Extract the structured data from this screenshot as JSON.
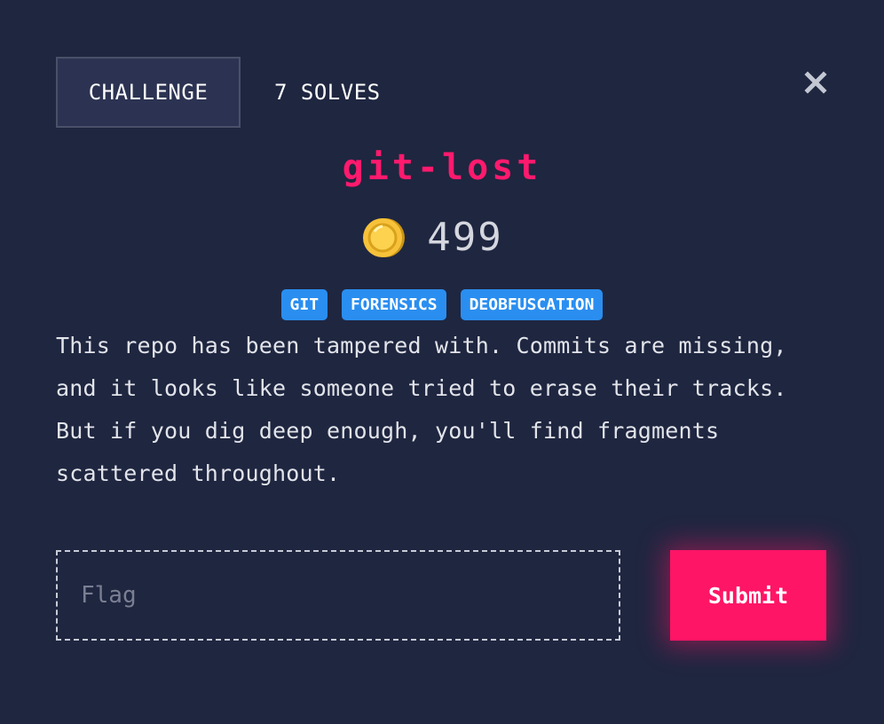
{
  "header": {
    "tab_challenge": "CHALLENGE",
    "tab_solves": "7 SOLVES"
  },
  "challenge": {
    "title": "git-lost",
    "value": "499",
    "tags": [
      "GIT",
      "FORENSICS",
      "DEOBFUSCATION"
    ],
    "description": "This repo has been tampered with. Commits are missing, and it looks like someone tried to erase their tracks. But if you dig deep enough, you'll find fragments scattered throughout."
  },
  "form": {
    "flag_placeholder": "Flag",
    "flag_value": "",
    "submit_label": "Submit"
  },
  "icons": {
    "close": "close-icon",
    "coin": "coin-icon"
  },
  "colors": {
    "background": "#1f2640",
    "title": "#ff1a6d",
    "tag": "#2a8ef0",
    "submit": "#ff1566",
    "coin": "#f7c23a"
  }
}
